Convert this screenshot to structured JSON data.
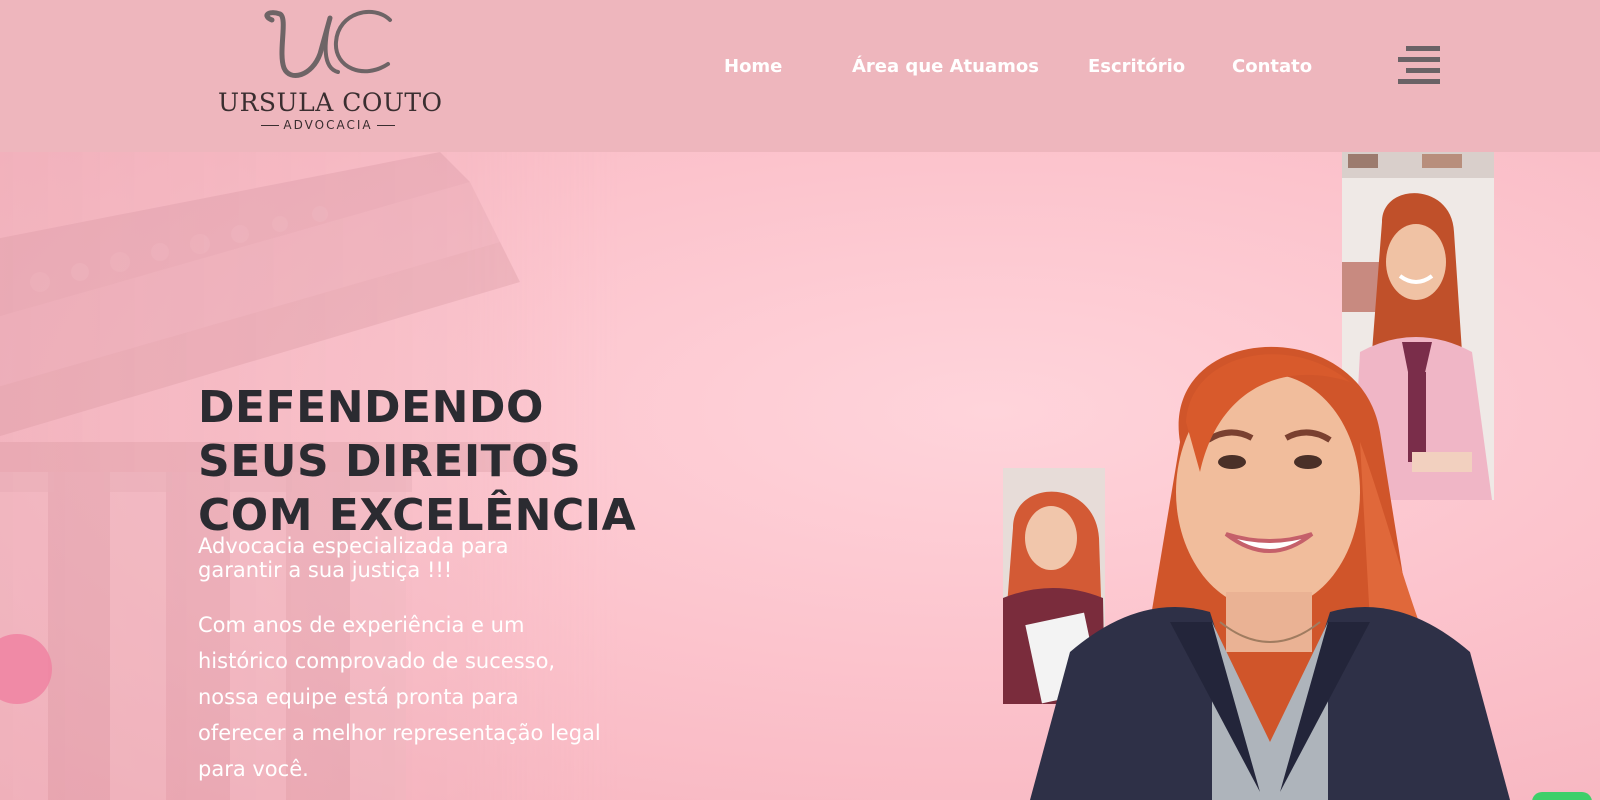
{
  "header": {
    "logo": {
      "monogram": "UC",
      "name": "URSULA COUTO",
      "subtitle": "ADVOCACIA"
    },
    "nav": [
      {
        "label": "Home"
      },
      {
        "label": "Área que Atuamos"
      },
      {
        "label": "Escritório"
      },
      {
        "label": "Contato"
      }
    ],
    "menu_icon": "hamburger-menu-icon"
  },
  "hero": {
    "title_lines": [
      "DEFENDENDO",
      "SEUS DIREITOS",
      "COM EXCELÊNCIA"
    ],
    "tagline_lines": [
      "Advocacia especializada para",
      "garantir a sua justiça !!!"
    ],
    "description_lines": [
      "Com anos de experiência e um",
      "histórico comprovado de sucesso,",
      "nossa equipe está pronta para",
      "oferecer a melhor representação legal",
      "para você."
    ]
  },
  "colors": {
    "header_bg": "#eeb6bd",
    "hero_bg": "#fcc4cd",
    "title": "#2b2b31",
    "text_light": "#ffffff",
    "logo_dark": "#3a2e30"
  }
}
